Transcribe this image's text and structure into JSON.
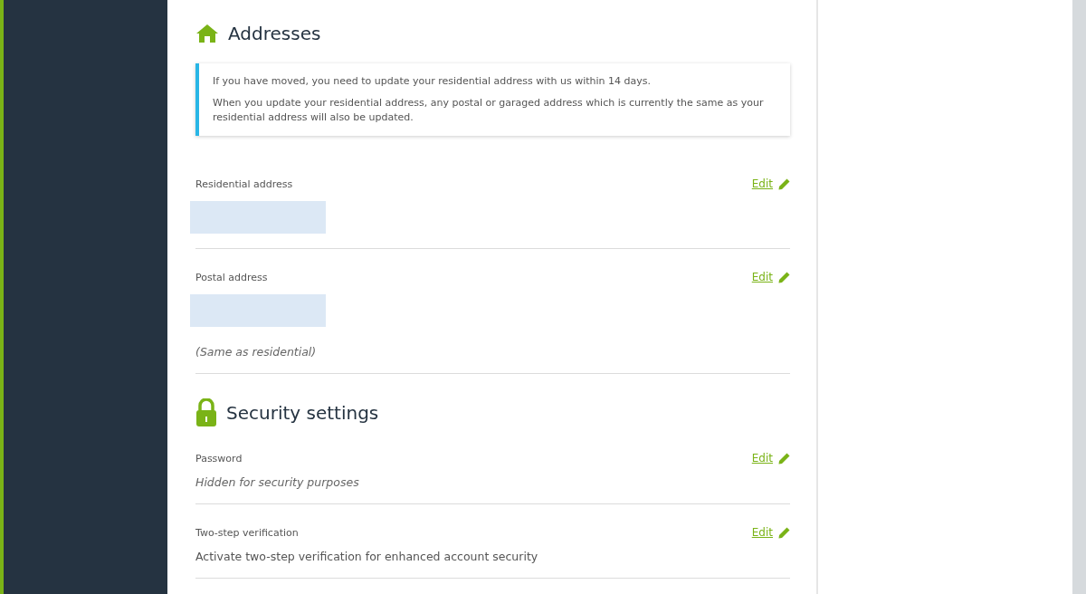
{
  "sections": [
    {
      "kind": "house",
      "title": "Addresses",
      "notice": [
        "If you have moved, you need to update your residential address with us within 14 days.",
        "When you update your residential address, any postal or garaged address which is currently the same as your residential address will also be updated."
      ],
      "fields": [
        {
          "label": "Residential address",
          "action": "Edit",
          "values": [
            {
              "kind": "redacted"
            }
          ]
        },
        {
          "label": "Postal address",
          "action": "Edit",
          "values": [
            {
              "kind": "redacted"
            },
            {
              "kind": "note",
              "text": "(Same as residential)"
            }
          ]
        }
      ]
    },
    {
      "kind": "lock",
      "title": "Security settings",
      "fields": [
        {
          "label": "Password",
          "action": "Edit",
          "values": [
            {
              "kind": "note",
              "text": "Hidden for security purposes"
            }
          ]
        },
        {
          "label": "Two-step verification",
          "action": "Edit",
          "values": [
            {
              "kind": "text",
              "text": "Activate two-step verification for enhanced account security"
            }
          ]
        }
      ]
    }
  ]
}
